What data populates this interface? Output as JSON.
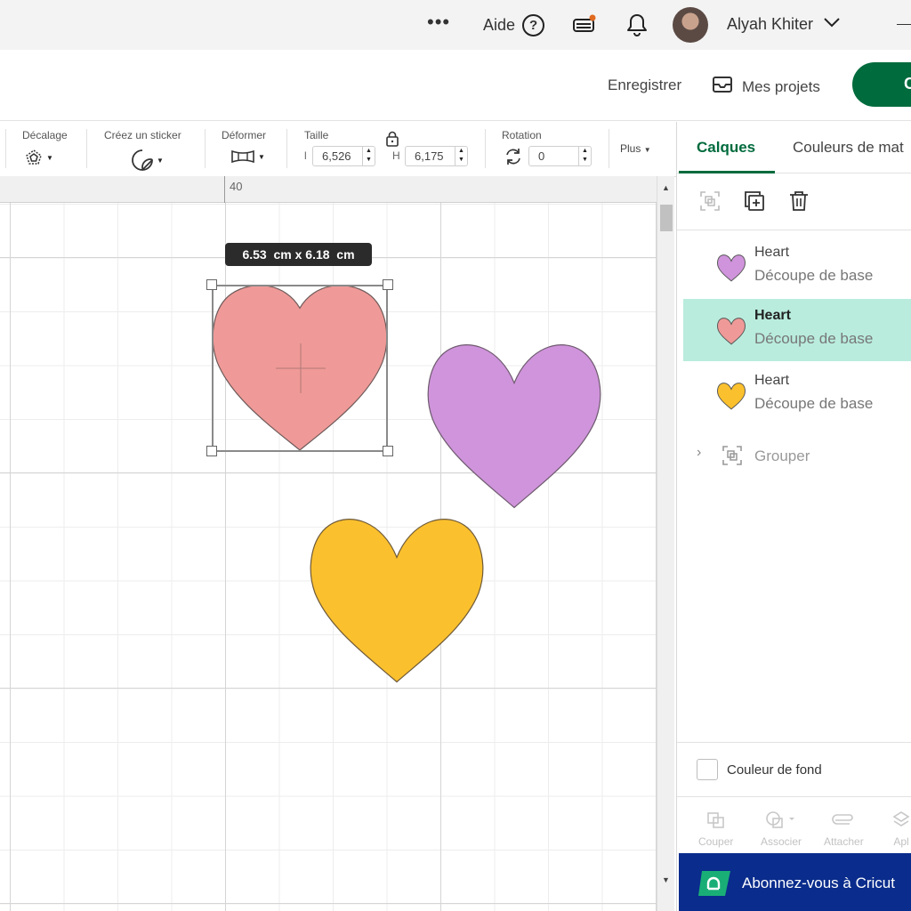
{
  "titlebar": {
    "more": "•••",
    "help_label": "Aide",
    "help_icon": "?",
    "username": "Alyah Khiter"
  },
  "header": {
    "save_label": "Enregistrer",
    "projects_label": "Mes projets",
    "make_label": "C"
  },
  "toolbar": {
    "offset_label": "Décalage",
    "sticker_label": "Créez un sticker",
    "warp_label": "Déformer",
    "size_label": "Taille",
    "width_prefix": "l",
    "width_value": "6,526",
    "height_prefix": "H",
    "height_value": "6,175",
    "rotation_label": "Rotation",
    "rotation_value": "0",
    "more_label": "Plus"
  },
  "canvas": {
    "ruler_label": "40",
    "dimension_tooltip": "6.53  cm x 6.18  cm",
    "hearts": [
      {
        "name": "heart-pink",
        "fill": "#ef9a98"
      },
      {
        "name": "heart-purple",
        "fill": "#cf94db"
      },
      {
        "name": "heart-yellow",
        "fill": "#fbc02d"
      }
    ]
  },
  "panel": {
    "tab_layers": "Calques",
    "tab_colors": "Couleurs de mat",
    "layers": [
      {
        "name": "Heart",
        "operation": "Découpe de base",
        "color": "#cf94db",
        "selected": false
      },
      {
        "name": "Heart",
        "operation": "Découpe de base",
        "color": "#ef9a98",
        "selected": true
      },
      {
        "name": "Heart",
        "operation": "Découpe de base",
        "color": "#fbc02d",
        "selected": false
      }
    ],
    "group_label": "Grouper",
    "background_color_label": "Couleur de fond",
    "actions": [
      "Couper",
      "Associer",
      "Attacher",
      "Apl"
    ],
    "subscribe_label": "Abonnez-vous à Cricut"
  },
  "colors": {
    "accent": "#006b3d",
    "selected_layer_bg": "#b9ecdd",
    "subscribe_bg": "#0a2c8c"
  }
}
